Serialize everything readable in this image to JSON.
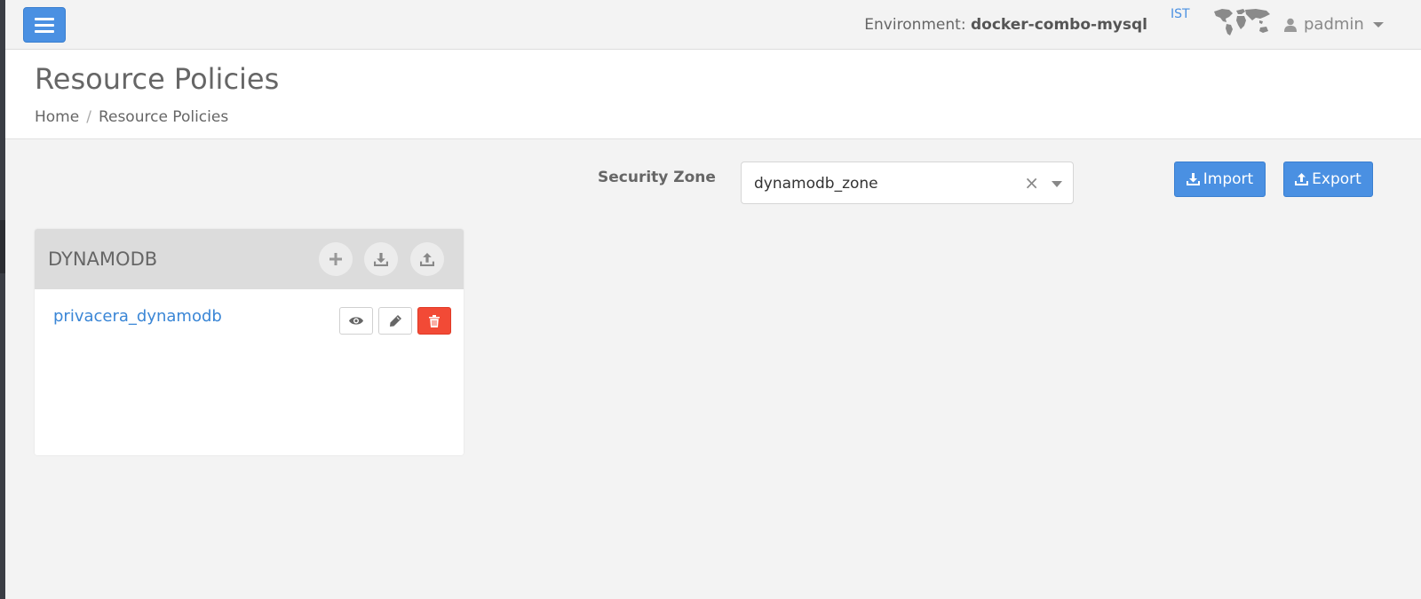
{
  "topbar": {
    "env_label": "Environment:",
    "env_value": "docker-combo-mysql",
    "timezone": "IST",
    "username": "padmin"
  },
  "header": {
    "title": "Resource Policies",
    "breadcrumb": [
      "Home",
      "Resource Policies"
    ]
  },
  "zone": {
    "label": "Security Zone",
    "selected": "dynamodb_zone",
    "clear_glyph": "×"
  },
  "actions": {
    "import_label": "Import",
    "export_label": "Export"
  },
  "service": {
    "title": "DYNAMODB",
    "header_icons": [
      "plus-icon",
      "download-icon",
      "upload-icon"
    ],
    "policies": [
      {
        "name": "privacera_dynamodb",
        "row_icons": [
          "eye-icon",
          "pencil-icon",
          "trash-icon"
        ]
      }
    ]
  },
  "colors": {
    "primary": "#4a90e2",
    "danger": "#f24a36",
    "link": "#3a86d6"
  }
}
